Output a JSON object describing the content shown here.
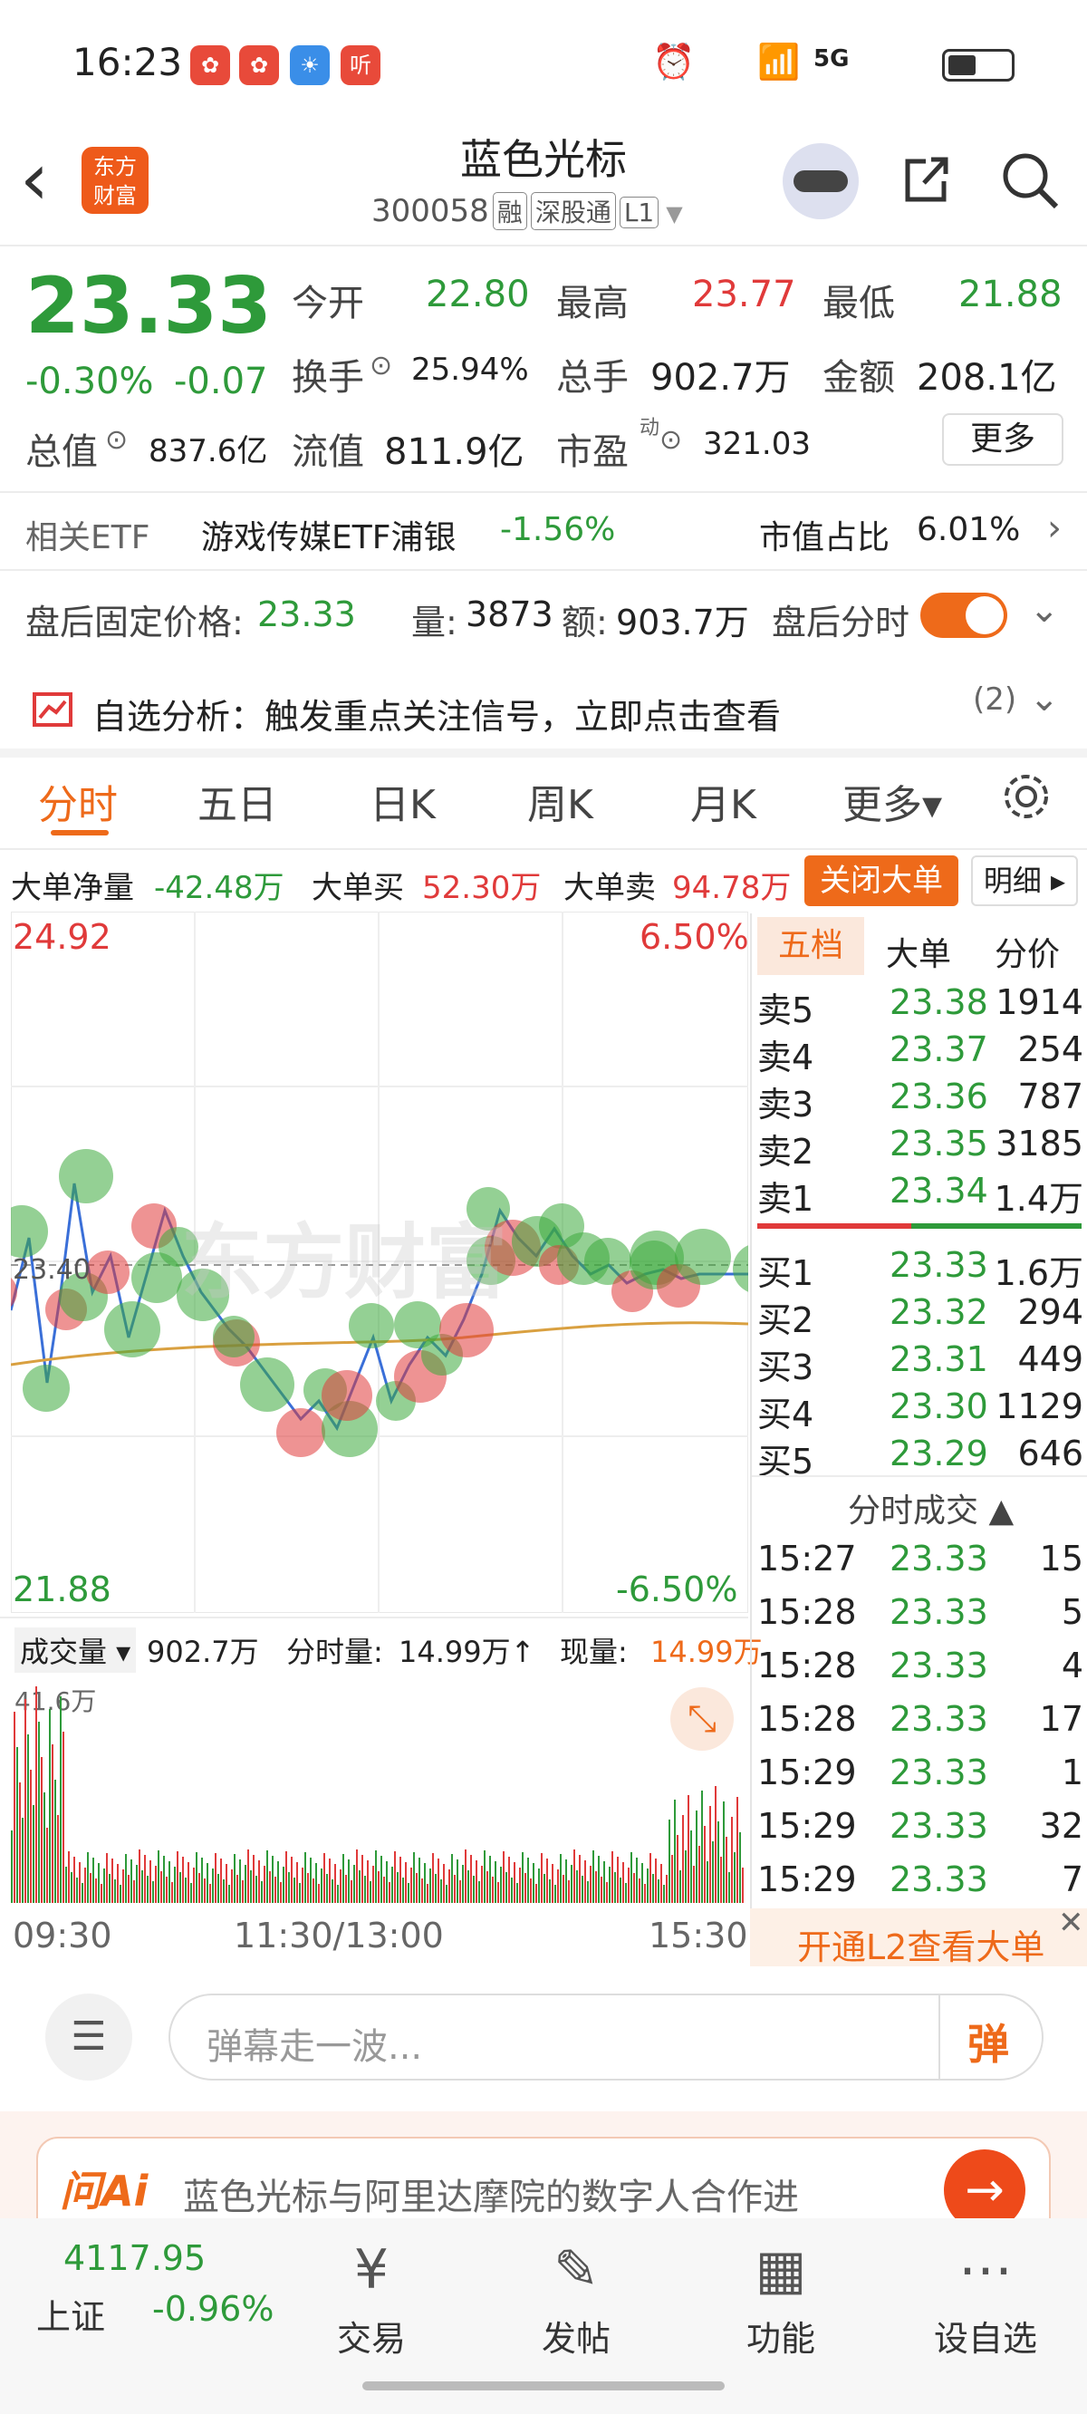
{
  "status": {
    "time": "16:23",
    "net": "5G"
  },
  "header": {
    "back": "‹",
    "logo": "东方\n财富",
    "title": "蓝色光标",
    "code": "300058",
    "tags": [
      "融",
      "深股通",
      "L1"
    ]
  },
  "quote": {
    "price": "23.33",
    "pct": "-0.30%",
    "chg": "-0.07",
    "open_l": "今开",
    "open": "22.80",
    "high_l": "最高",
    "high": "23.77",
    "low_l": "最低",
    "low": "21.88",
    "turn_l": "换手",
    "turn": "25.94%",
    "vol_l": "总手",
    "vol": "902.7万",
    "amt_l": "金额",
    "amt": "208.1亿",
    "mcap_l": "总值",
    "mcap": "837.6亿",
    "fcap_l": "流值",
    "fcap": "811.9亿",
    "pe_l": "市盈",
    "pe_sup": "动",
    "pe": "321.03",
    "more": "更多"
  },
  "etf": {
    "l": "相关ETF",
    "name": "游戏传媒ETF浦银",
    "pct": "-1.56%",
    "share_l": "市值占比",
    "share": "6.01%"
  },
  "after": {
    "l": "盘后固定价格:",
    "price": "23.33",
    "vol_l": "量:",
    "vol": "3873",
    "amt_l": "额:",
    "amt": "903.7万",
    "toggle": "盘后分时"
  },
  "alert": {
    "text": "自选分析：触发重点关注信号，立即点击查看",
    "count": "(2)"
  },
  "tabs": [
    "分时",
    "五日",
    "日K",
    "周K",
    "月K",
    "更多▾"
  ],
  "bigorder": {
    "net_l": "大单净量",
    "net": "-42.48万",
    "buy_l": "大单买",
    "buy": "52.30万",
    "sell_l": "大单卖",
    "sell": "94.78万",
    "close": "关闭大单",
    "detail": "明细 ▸"
  },
  "chart": {
    "ymax": "24.92",
    "ymin": "21.88",
    "pmax": "6.50%",
    "pmin": "-6.50%",
    "mid": "23.40",
    "watermark": "东方财富",
    "vol_l": "成交量 ▾",
    "vol": "902.7万",
    "min_l": "分时量:",
    "min": "14.99万↑",
    "now_l": "现量:",
    "now": "14.99万",
    "vmax": "41.6万",
    "t0": "09:30",
    "t1": "11:30/13:00",
    "t2": "15:30"
  },
  "orderbook": {
    "tabs": [
      "五档",
      "大单",
      "分价"
    ],
    "asks": [
      {
        "l": "卖5",
        "p": "23.38",
        "v": "1914"
      },
      {
        "l": "卖4",
        "p": "23.37",
        "v": "254"
      },
      {
        "l": "卖3",
        "p": "23.36",
        "v": "787"
      },
      {
        "l": "卖2",
        "p": "23.35",
        "v": "3185"
      },
      {
        "l": "卖1",
        "p": "23.34",
        "v": "1.4万"
      }
    ],
    "bids": [
      {
        "l": "买1",
        "p": "23.33",
        "v": "1.6万"
      },
      {
        "l": "买2",
        "p": "23.32",
        "v": "294"
      },
      {
        "l": "买3",
        "p": "23.31",
        "v": "449"
      },
      {
        "l": "买4",
        "p": "23.30",
        "v": "1129"
      },
      {
        "l": "买5",
        "p": "23.29",
        "v": "646"
      }
    ],
    "ticks_l": "分时成交 ▲",
    "ticks": [
      {
        "t": "15:27",
        "p": "23.33",
        "v": "15"
      },
      {
        "t": "15:28",
        "p": "23.33",
        "v": "5"
      },
      {
        "t": "15:28",
        "p": "23.33",
        "v": "4"
      },
      {
        "t": "15:28",
        "p": "23.33",
        "v": "17"
      },
      {
        "t": "15:29",
        "p": "23.33",
        "v": "1"
      },
      {
        "t": "15:29",
        "p": "23.33",
        "v": "32"
      },
      {
        "t": "15:29",
        "p": "23.33",
        "v": "7"
      }
    ],
    "l2": "开通L2查看大单"
  },
  "comment": {
    "placeholder": "弹幕走一波...",
    "send": "弹"
  },
  "ai": {
    "logo": "问Ai",
    "text": "蓝色光标与阿里达摩院的数字人合作进"
  },
  "nav": {
    "index_val": "4117.95",
    "index_l": "上证",
    "index_pct": "-0.96%",
    "items": [
      "交易",
      "发帖",
      "功能",
      "设自选"
    ]
  }
}
